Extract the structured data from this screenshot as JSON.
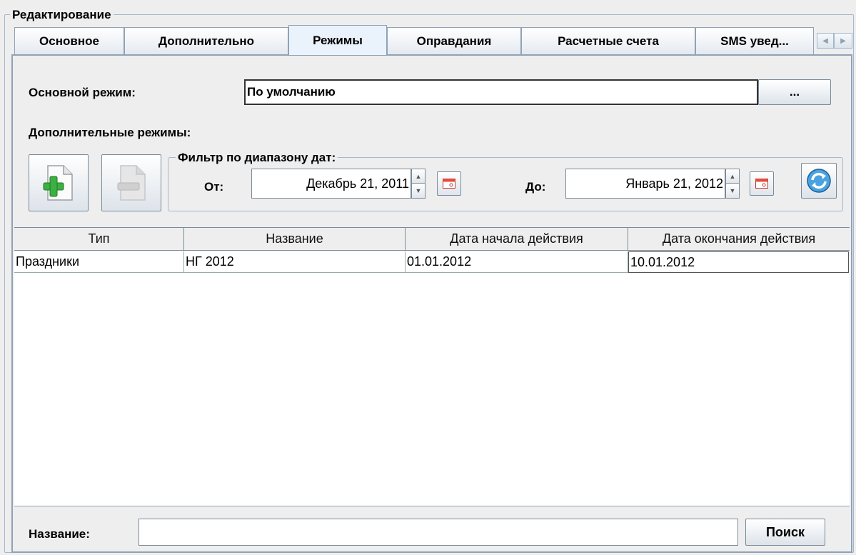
{
  "group_title": "Редактирование",
  "tabs": [
    {
      "label": "Основное"
    },
    {
      "label": "Дополнительно"
    },
    {
      "label": "Режимы"
    },
    {
      "label": "Оправдания"
    },
    {
      "label": "Расчетные счета"
    },
    {
      "label": "SMS увед..."
    }
  ],
  "selected_tab": "Режимы",
  "main_mode": {
    "label": "Основной режим:",
    "value": "По умолчанию",
    "browse_button": "..."
  },
  "additional_modes_label": "Дополнительные режимы:",
  "filter": {
    "title": "Фильтр по диапазону дат:",
    "from_label": "От:",
    "from_value": "Декабрь 21, 2011",
    "to_label": "До:",
    "to_value": "Январь 21, 2012"
  },
  "table": {
    "columns": [
      "Тип",
      "Название",
      "Дата начала действия",
      "Дата окончания действия"
    ],
    "rows": [
      [
        "Праздники",
        "НГ 2012",
        "01.01.2012",
        "10.01.2012"
      ]
    ]
  },
  "search": {
    "label": "Название:",
    "value": "",
    "button": "Поиск"
  },
  "icons": {
    "add": "add-document-icon",
    "remove": "remove-document-icon",
    "refresh": "refresh-icon",
    "calendar": "calendar-icon"
  }
}
